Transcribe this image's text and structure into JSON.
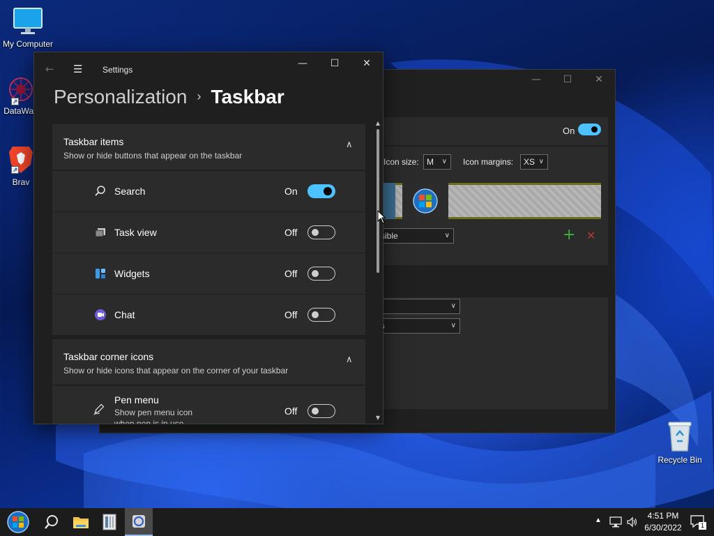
{
  "desktop": {
    "icons": [
      {
        "label": "My Computer",
        "icon": "monitor-icon"
      },
      {
        "label": "DataWag",
        "icon": "datawag-icon"
      },
      {
        "label": "Brav",
        "icon": "brave-icon"
      },
      {
        "label": "Recycle Bin",
        "icon": "recycle-bin-icon"
      }
    ]
  },
  "background_window": {
    "controls": {
      "minimize": "—",
      "maximize": "☐",
      "close": "✕"
    },
    "on_label": "On",
    "icon_size_label": "Icon size:",
    "icon_size_value": "M",
    "icon_margins_label": "Icon margins:",
    "icon_margins_value": "XS",
    "visibility_select": "sible",
    "select_two": "ls",
    "add_icon": "+",
    "remove_icon": "✕"
  },
  "settings": {
    "title": "Settings",
    "breadcrumb": {
      "parent": "Personalization",
      "separator": "›",
      "current": "Taskbar"
    },
    "controls": {
      "back": "←",
      "menu": "☰",
      "minimize": "—",
      "maximize": "☐",
      "close": "✕"
    },
    "taskbar_items": {
      "title": "Taskbar items",
      "subtitle": "Show or hide buttons that appear on the taskbar",
      "rows": [
        {
          "label": "Search",
          "state": "On",
          "on": true,
          "icon": "search-icon"
        },
        {
          "label": "Task view",
          "state": "Off",
          "on": false,
          "icon": "task-view-icon"
        },
        {
          "label": "Widgets",
          "state": "Off",
          "on": false,
          "icon": "widgets-icon"
        },
        {
          "label": "Chat",
          "state": "Off",
          "on": false,
          "icon": "chat-icon"
        }
      ]
    },
    "corner_icons": {
      "title": "Taskbar corner icons",
      "subtitle": "Show or hide icons that appear on the corner of your taskbar",
      "rows": [
        {
          "label": "Pen menu",
          "desc_line1": "Show pen menu icon",
          "desc_line2": "when pen is in use",
          "state": "Off",
          "on": false,
          "icon": "pen-icon"
        }
      ]
    }
  },
  "taskbar": {
    "buttons": [
      {
        "name": "start-button",
        "icon": "windows-orb-icon"
      },
      {
        "name": "search-button",
        "icon": "search-icon"
      },
      {
        "name": "file-explorer-button",
        "icon": "folder-icon"
      },
      {
        "name": "app-button",
        "icon": "book-icon"
      },
      {
        "name": "settings-app-button",
        "icon": "settings-app-icon"
      }
    ],
    "clock": {
      "time": "4:51 PM",
      "date": "6/30/2022"
    },
    "notification_count": "1",
    "tray_icons": [
      "chevron-up-icon",
      "network-icon",
      "volume-icon",
      "notification-icon"
    ]
  },
  "colors": {
    "accent": "#4cc2ff",
    "window_bg": "#1f1f1f",
    "card_bg": "#2b2b2b",
    "taskbar_bg": "#1c1c1c"
  }
}
